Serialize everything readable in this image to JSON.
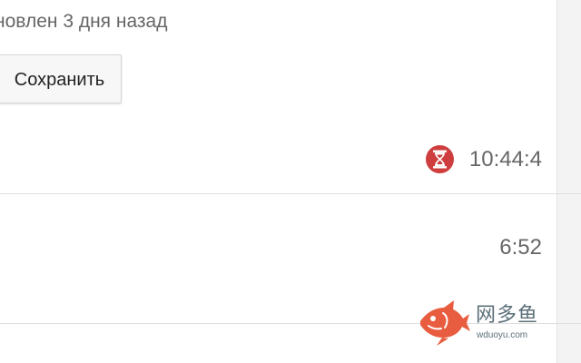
{
  "header": {
    "updated_text": "новлен 3 дня назад"
  },
  "toolbar": {
    "save_label": "Сохранить"
  },
  "rows": [
    {
      "time": "10:44:4",
      "icon": "hourglass-icon"
    },
    {
      "time": "6:52"
    }
  ],
  "watermark": {
    "brand": "网多鱼",
    "url": "wduoyu.com",
    "icon": "fish-logo-icon"
  },
  "colors": {
    "timer_badge": "#cf3e3e",
    "fish_logo": "#e85d3f",
    "watermark_text": "#5c6f78"
  }
}
